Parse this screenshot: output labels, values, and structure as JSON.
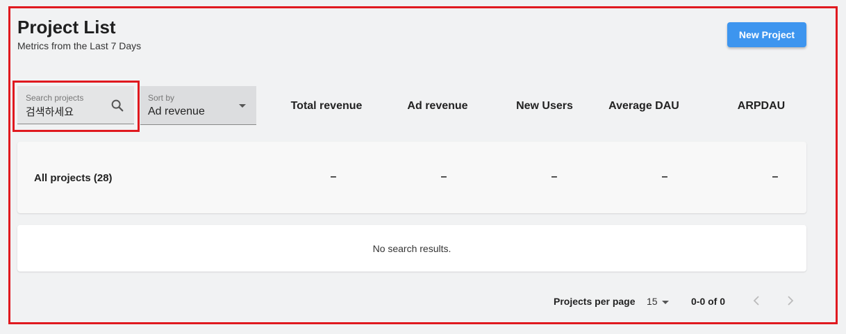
{
  "header": {
    "title": "Project List",
    "subtitle": "Metrics from the Last 7 Days",
    "new_project_label": "New Project",
    "accent_color": "#3d95ef"
  },
  "search": {
    "label": "Search projects",
    "value": "검색하세요",
    "icon": "search-icon"
  },
  "sort": {
    "label": "Sort by",
    "value": "Ad revenue"
  },
  "columns": [
    "Total revenue",
    "Ad revenue",
    "New Users",
    "Average DAU",
    "ARPDAU"
  ],
  "summary": {
    "name": "All projects (28)",
    "values": [
      "–",
      "–",
      "–",
      "–",
      "–"
    ]
  },
  "empty_state": "No search results.",
  "pagination": {
    "per_page_label": "Projects per page",
    "per_page_value": "15",
    "range": "0-0 of 0",
    "prev_icon": "chevron-left-icon",
    "next_icon": "chevron-right-icon"
  },
  "highlight_color": "#e0191f"
}
